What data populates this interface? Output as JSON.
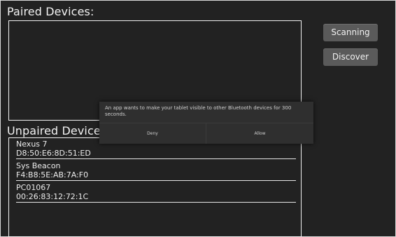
{
  "paired_section": {
    "heading": "Paired Devices:"
  },
  "unpaired_section": {
    "heading": "Unpaired Devices:",
    "devices": [
      {
        "name": "Nexus 7",
        "address": "D8:50:E6:8D:51:ED"
      },
      {
        "name": "Sys Beacon",
        "address": "F4:B8:5E:AB:7A:F0"
      },
      {
        "name": "PC01067",
        "address": "00:26:83:12:72:1C"
      }
    ]
  },
  "side_buttons": {
    "scanning_label": "Scanning",
    "discover_label": "Discover"
  },
  "dialog": {
    "message": "An app wants to make your tablet visible to other Bluetooth devices for 300 seconds.",
    "deny_label": "Deny",
    "allow_label": "Allow"
  }
}
